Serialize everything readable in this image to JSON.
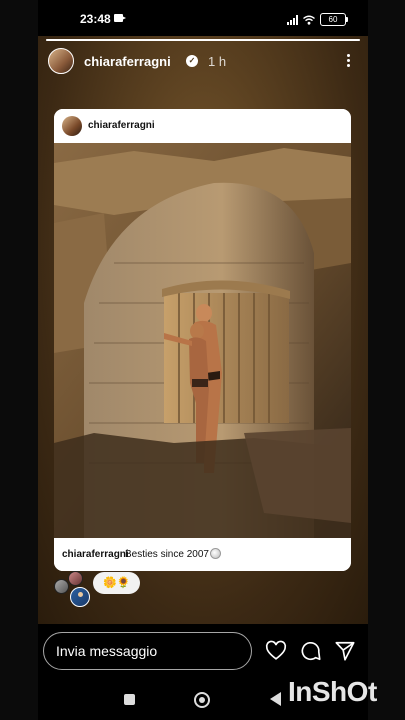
{
  "status_bar": {
    "time": "23:48",
    "battery": "60"
  },
  "story": {
    "progress": 1.0,
    "username": "chiaraferragni",
    "time_ago": "1 h",
    "verified": true
  },
  "shared_post": {
    "username": "chiaraferragni",
    "caption_user": "chiaraferragni",
    "caption_text": "Besties since 2007",
    "caption_emoji": "shell-emoji"
  },
  "reaction": {
    "text": "🌼🌻"
  },
  "footer": {
    "message_placeholder": "Invia messaggio"
  },
  "watermark": {
    "text": "InShOt"
  },
  "colors": {
    "story_bg": "#5a4020",
    "card_bg": "#ffffff"
  },
  "icons": [
    "heart-icon",
    "comment-icon",
    "send-icon",
    "more-icon",
    "verified-icon"
  ]
}
